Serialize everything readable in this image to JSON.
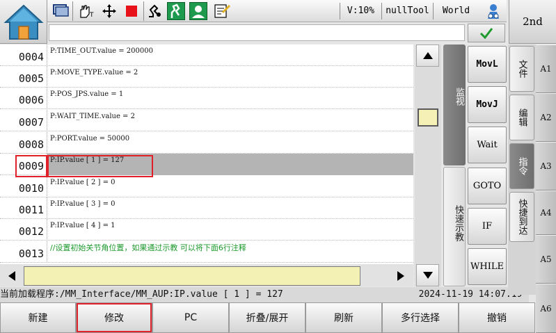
{
  "toolbar": {
    "velocity": "V:10%",
    "tool": "nullTool",
    "frame": "World",
    "second_key": "2nd",
    "stop_color": "#e8121b"
  },
  "program_lines": [
    {
      "num": "0004",
      "text": "P:TIME_OUT.value = 200000",
      "selected": false
    },
    {
      "num": "0005",
      "text": "P:MOVE_TYPE.value = 2",
      "selected": false
    },
    {
      "num": "0006",
      "text": "P:POS_JPS.value = 1",
      "selected": false
    },
    {
      "num": "0007",
      "text": "P:WAIT_TIME.value = 2",
      "selected": false
    },
    {
      "num": "0008",
      "text": "P:PORT.value = 50000",
      "selected": false
    },
    {
      "num": "0009",
      "text": "P:IP.value [ 1 ] = 127",
      "selected": true
    },
    {
      "num": "0010",
      "text": "P:IP.value [ 2 ] = 0",
      "selected": false
    },
    {
      "num": "0011",
      "text": "P:IP.value [ 3 ] = 0",
      "selected": false
    },
    {
      "num": "0012",
      "text": "P:IP.value [ 4 ] = 1",
      "selected": false
    },
    {
      "num": "0013",
      "text": "//设置初始关节角位置，如果通过示教 可以将下面6行注释",
      "selected": false
    }
  ],
  "status": {
    "program": "当前加载程序:/MM_Interface/MM_AUP:IP.value [ 1 ] = 127",
    "datetime": "2024-11-19 14:07:19"
  },
  "side_tabs": {
    "monitor": "监视",
    "quick_teach": "快速示教"
  },
  "instructions": [
    "MovL",
    "MovJ",
    "Wait",
    "GOTO",
    "IF",
    "WHILE"
  ],
  "function_tabs": [
    {
      "label": "文件",
      "active": false
    },
    {
      "label": "编辑",
      "active": false
    },
    {
      "label": "指令",
      "active": true
    },
    {
      "label": "快捷到达",
      "active": false
    }
  ],
  "a_keys": [
    "A1",
    "A2",
    "A3",
    "A4",
    "A5",
    "A6"
  ],
  "bottom_buttons": [
    "新建",
    "修改",
    "PC",
    "折叠/展开",
    "刷新",
    "多行选择",
    "撤销"
  ]
}
